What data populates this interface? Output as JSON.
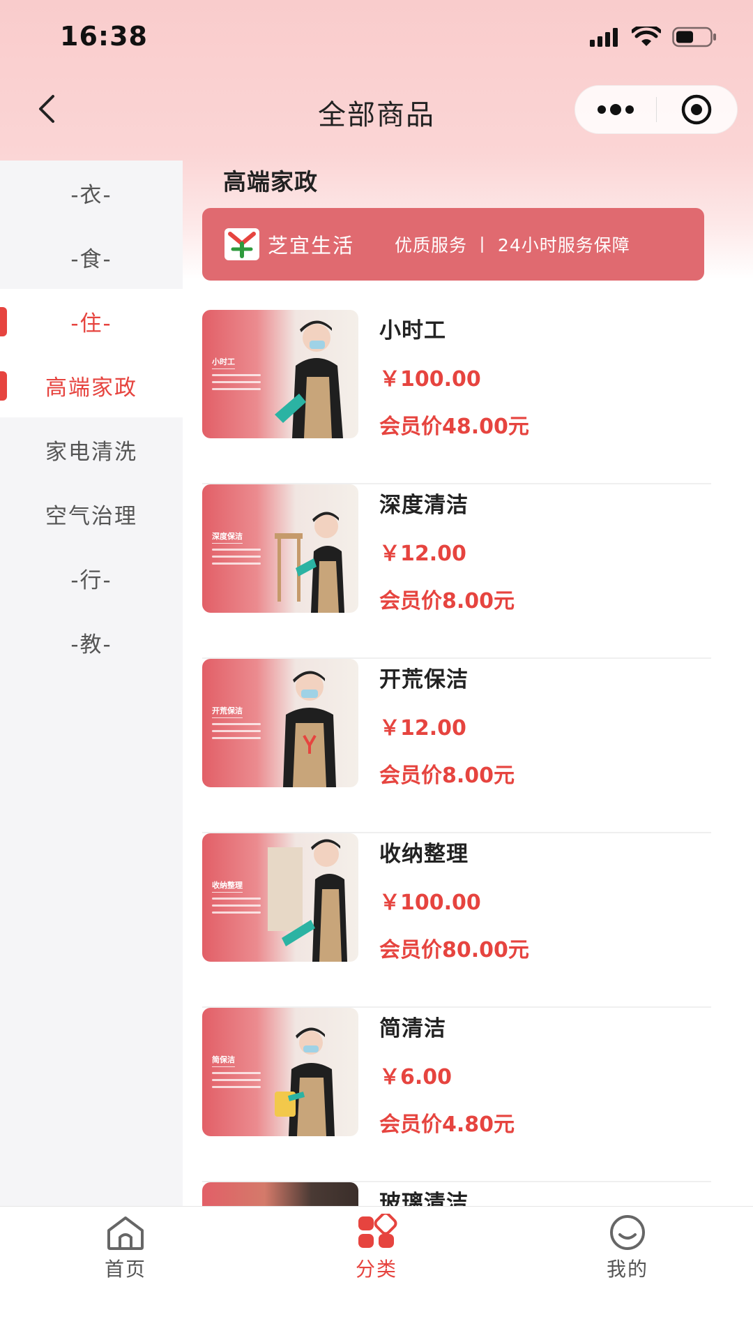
{
  "status_bar": {
    "time": "16:38"
  },
  "nav": {
    "title": "全部商品"
  },
  "sidebar": {
    "items": [
      {
        "label": "-衣-"
      },
      {
        "label": "-食-"
      },
      {
        "label": "-住-"
      },
      {
        "label": "高端家政"
      },
      {
        "label": "家电清洗"
      },
      {
        "label": "空气治理"
      },
      {
        "label": "-行-"
      },
      {
        "label": "-教-"
      }
    ]
  },
  "content": {
    "section_title": "高端家政",
    "banner": {
      "brand": "芝宜生活",
      "slogan": "优质服务 丨 24小时服务保障"
    },
    "products": [
      {
        "name": "小时工",
        "price": "￥100.00",
        "member_price": "会员价48.00元",
        "thumb_label": "小时工"
      },
      {
        "name": "深度清洁",
        "price": "￥12.00",
        "member_price": "会员价8.00元",
        "thumb_label": "深度保洁"
      },
      {
        "name": "开荒保洁",
        "price": "￥12.00",
        "member_price": "会员价8.00元",
        "thumb_label": "开荒保洁"
      },
      {
        "name": "收纳整理",
        "price": "￥100.00",
        "member_price": "会员价80.00元",
        "thumb_label": "收纳整理"
      },
      {
        "name": "简清洁",
        "price": "￥6.00",
        "member_price": "会员价4.80元",
        "thumb_label": "简保洁"
      },
      {
        "name": "玻璃清洁"
      }
    ]
  },
  "tabbar": {
    "items": [
      {
        "label": "首页",
        "icon": "home-icon"
      },
      {
        "label": "分类",
        "icon": "category-icon"
      },
      {
        "label": "我的",
        "icon": "profile-icon"
      }
    ]
  },
  "colors": {
    "accent": "#e6443f",
    "banner": "#e06a70",
    "header_top": "#f9cccc"
  }
}
